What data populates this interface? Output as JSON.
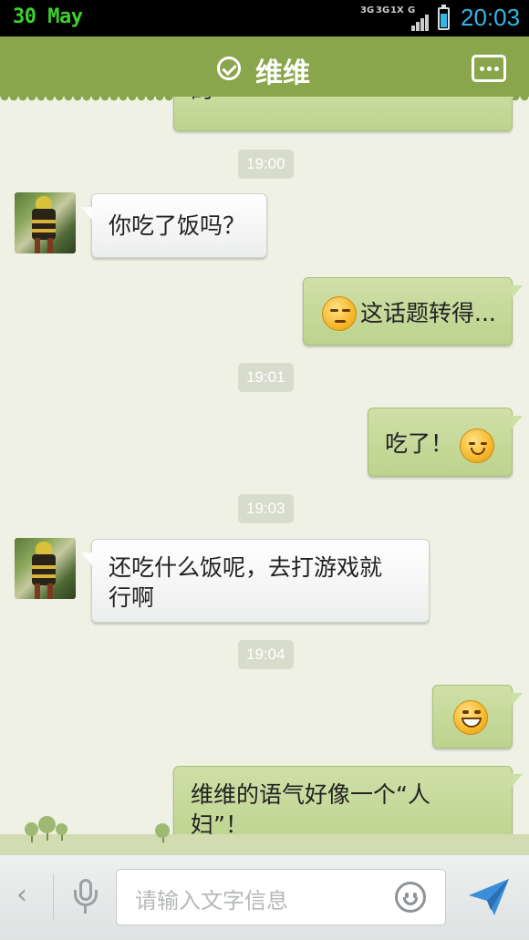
{
  "status_bar": {
    "date": "30 May",
    "net_labels": [
      "3G",
      "3G",
      "1X",
      "G"
    ],
    "time": "20:03"
  },
  "header": {
    "title": "维维"
  },
  "messages": {
    "partial_top": "的",
    "t1": "19:00",
    "m1": "你吃了饭吗？",
    "m2": "这话题转得...",
    "t2": "19:01",
    "m3": "吃了！",
    "t3": "19:03",
    "m4_line1": "还吃什么饭呢，去打游戏就",
    "m4_line2": "行啊",
    "t4": "19:04",
    "m6_line1": "维维的语气好像一个“人",
    "m6_line2": "妇”！"
  },
  "input": {
    "placeholder": "请输入文字信息"
  },
  "colors": {
    "title_bar": "#8aa64c",
    "bubble_out": "#c8dc9c",
    "bubble_in": "#f6f7f6",
    "time_accent": "#33b5e5",
    "date_accent": "#3ecf2e"
  }
}
